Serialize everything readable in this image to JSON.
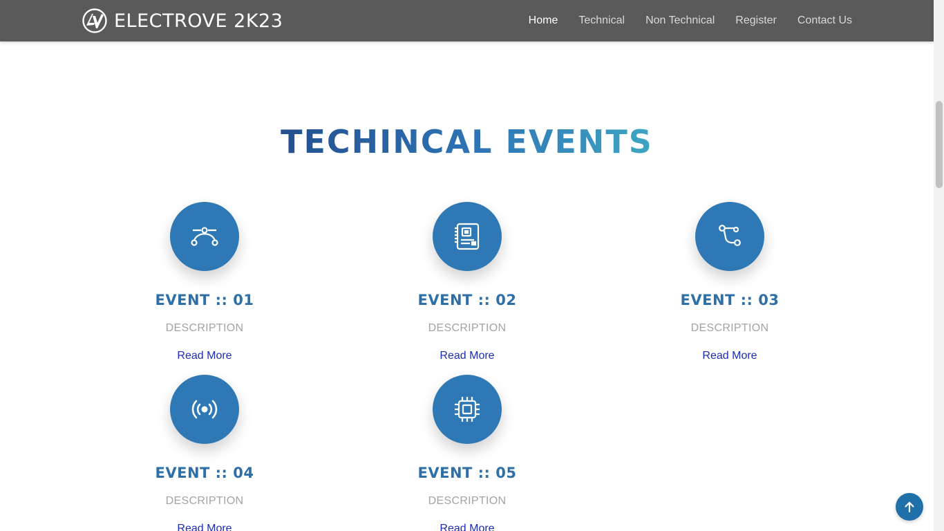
{
  "brand": {
    "name": "ELECTROVE 2K23",
    "logo_icon": "ev-logo-icon"
  },
  "nav": {
    "items": [
      {
        "label": "Home",
        "active": true
      },
      {
        "label": "Technical",
        "active": false
      },
      {
        "label": "Non Technical",
        "active": false
      },
      {
        "label": "Register",
        "active": false
      },
      {
        "label": "Contact Us",
        "active": false
      }
    ]
  },
  "section": {
    "title": "TECHINCAL EVENTS"
  },
  "events": [
    {
      "title": "EVENT :: 01",
      "description": "DESCRIPTION",
      "link": "Read More",
      "icon": "bezier-curve-icon"
    },
    {
      "title": "EVENT :: 02",
      "description": "DESCRIPTION",
      "link": "Read More",
      "icon": "motherboard-icon"
    },
    {
      "title": "EVENT :: 03",
      "description": "DESCRIPTION",
      "link": "Read More",
      "icon": "vector-path-icon"
    },
    {
      "title": "EVENT :: 04",
      "description": "DESCRIPTION",
      "link": "Read More",
      "icon": "broadcast-icon"
    },
    {
      "title": "EVENT :: 05",
      "description": "DESCRIPTION",
      "link": "Read More",
      "icon": "cpu-chip-icon"
    }
  ],
  "colors": {
    "navbar": "#5a5a5a",
    "accent": "#2e79b5",
    "title_gradient_start": "#24508f",
    "title_gradient_end": "#3ea5c2",
    "link": "#1b2bb8",
    "muted": "#a3a3a3"
  },
  "back_to_top": {
    "icon": "arrow-up-icon"
  }
}
